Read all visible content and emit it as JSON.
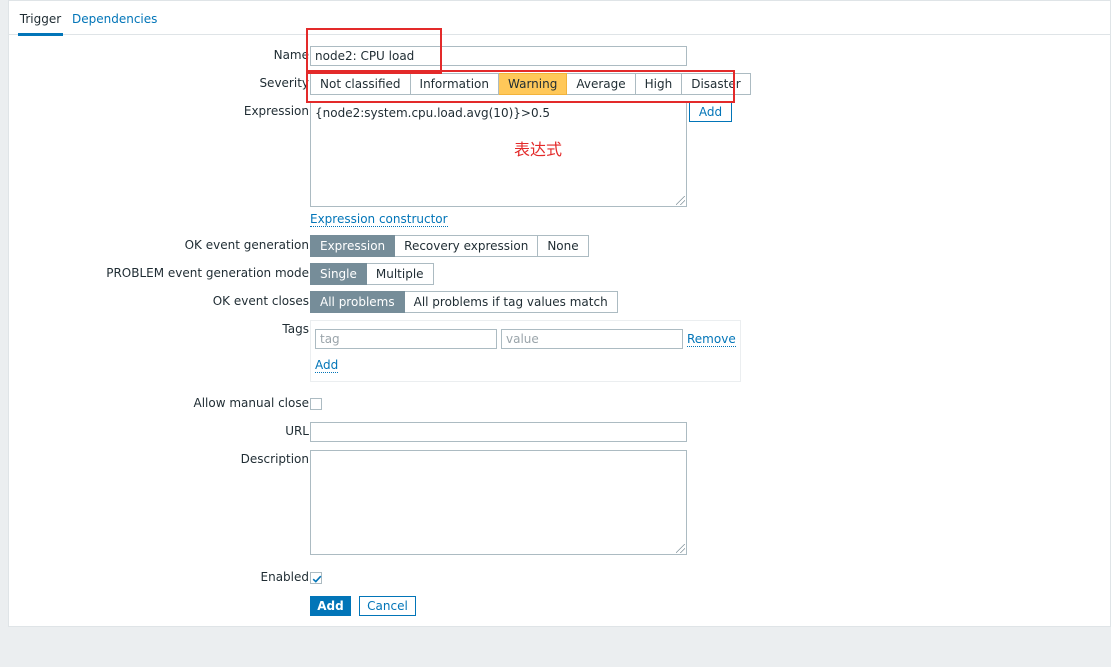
{
  "tabs": [
    {
      "label": "Trigger",
      "active": true
    },
    {
      "label": "Dependencies",
      "active": false
    }
  ],
  "form": {
    "name": {
      "label": "Name",
      "value": "node2: CPU load"
    },
    "severity": {
      "label": "Severity",
      "options": [
        "Not classified",
        "Information",
        "Warning",
        "Average",
        "High",
        "Disaster"
      ],
      "selected": "Warning"
    },
    "expression": {
      "label": "Expression",
      "value": "{node2:system.cpu.load.avg(10)}>0.5",
      "add_button": "Add",
      "constructor_link": "Expression constructor"
    },
    "ok_event_generation": {
      "label": "OK event generation",
      "options": [
        "Expression",
        "Recovery expression",
        "None"
      ],
      "selected": "Expression"
    },
    "problem_event_mode": {
      "label": "PROBLEM event generation mode",
      "options": [
        "Single",
        "Multiple"
      ],
      "selected": "Single"
    },
    "ok_event_closes": {
      "label": "OK event closes",
      "options": [
        "All problems",
        "All problems if tag values match"
      ],
      "selected": "All problems"
    },
    "tags": {
      "label": "Tags",
      "tag_placeholder": "tag",
      "value_placeholder": "value",
      "remove_link": "Remove",
      "add_link": "Add"
    },
    "allow_manual_close": {
      "label": "Allow manual close",
      "checked": false
    },
    "url": {
      "label": "URL",
      "value": ""
    },
    "description": {
      "label": "Description",
      "value": ""
    },
    "enabled": {
      "label": "Enabled",
      "checked": true
    },
    "actions": {
      "add": "Add",
      "cancel": "Cancel"
    }
  },
  "annotation": {
    "text": "表达式",
    "color": "#e32a2a"
  },
  "colors": {
    "accent": "#0275b8",
    "warning": "#ffc859",
    "selected_gray": "#768d99"
  }
}
